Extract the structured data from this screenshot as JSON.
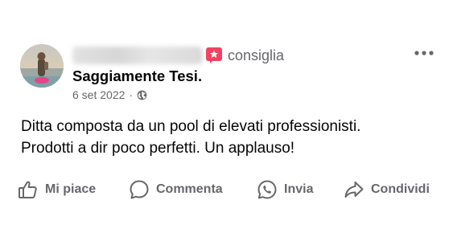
{
  "post": {
    "author_blurred": true,
    "recommend_label": "consiglia",
    "page_name": "Saggiamente Tesi",
    "page_name_suffix": ".",
    "date": "6 set 2022",
    "separator": "·",
    "visibility_icon": "globe-icon",
    "more_icon": "more-horizontal-icon",
    "body_lines": [
      "Ditta composta da un pool di elevati professionisti.",
      "Prodotti a dir poco perfetti. Un applauso!"
    ]
  },
  "actions": [
    {
      "label": "Mi piace",
      "icon": "thumbs-up-icon"
    },
    {
      "label": "Commenta",
      "icon": "comment-icon"
    },
    {
      "label": "Invia",
      "icon": "whatsapp-icon"
    },
    {
      "label": "Condividi",
      "icon": "share-icon"
    }
  ],
  "colors": {
    "secondary_text": "#65676b",
    "primary_text": "#050505",
    "recommend_badge": "#f3425f",
    "background": "#ffffff"
  }
}
